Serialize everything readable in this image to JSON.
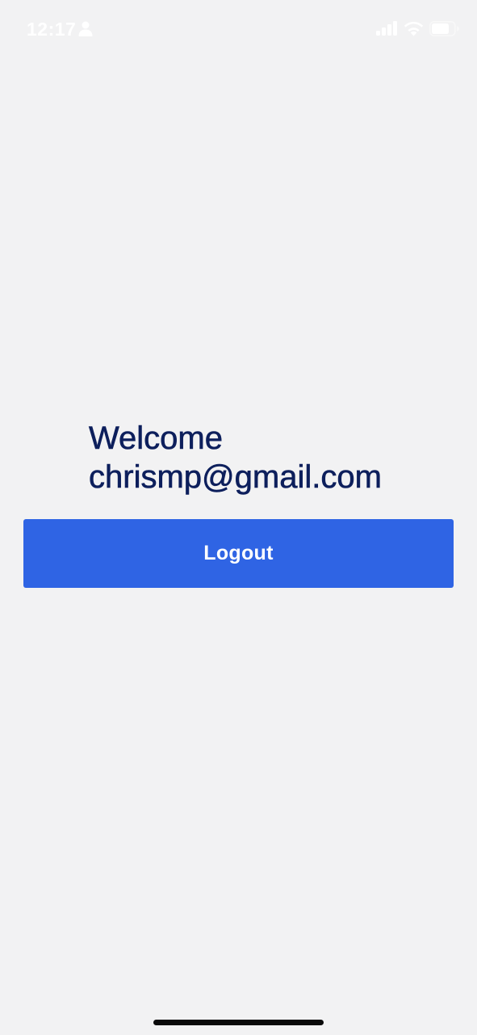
{
  "status_bar": {
    "time": "12:17",
    "icons": [
      "person-icon",
      "signal-icon",
      "wifi-icon",
      "battery-icon"
    ]
  },
  "welcome": {
    "greeting": "Welcome",
    "email": "chrismp@gmail.com"
  },
  "actions": {
    "logout_label": "Logout"
  },
  "colors": {
    "background": "#f2f2f3",
    "text_primary": "#0d1f5c",
    "button_primary": "#2f64e4",
    "button_text": "#ffffff",
    "status_bar_text": "#ffffff"
  }
}
